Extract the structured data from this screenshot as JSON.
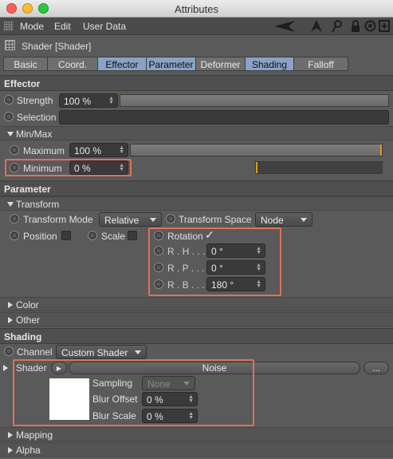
{
  "window": {
    "title": "Attributes"
  },
  "menu": {
    "items": [
      "Mode",
      "Edit",
      "User Data"
    ]
  },
  "toolbar_icons": [
    "pointer-arrow-icon",
    "cursor-up-icon",
    "search-icon",
    "lock-icon",
    "target-icon",
    "new-window-icon"
  ],
  "object": {
    "name": "Shader [Shader]"
  },
  "tabs": [
    {
      "label": "Basic",
      "active": false
    },
    {
      "label": "Coord.",
      "active": false
    },
    {
      "label": "Effector",
      "active": true
    },
    {
      "label": "Parameter",
      "active": true
    },
    {
      "label": "Deformer",
      "active": false
    },
    {
      "label": "Shading",
      "active": true
    },
    {
      "label": "Falloff",
      "active": false
    }
  ],
  "effector": {
    "header": "Effector",
    "strength": {
      "label": "Strength",
      "value": "100 %",
      "level": 1.0
    },
    "selection": {
      "label": "Selection",
      "value": ""
    },
    "minmax": {
      "header": "Min/Max",
      "maximum": {
        "label": "Maximum",
        "value": "100 %",
        "level": 1.0
      },
      "minimum": {
        "label": "Minimum",
        "value": "0 %",
        "level": 0.0
      }
    }
  },
  "parameter": {
    "header": "Parameter",
    "transform": {
      "header": "Transform",
      "mode_label": "Transform Mode",
      "mode_value": "Relative",
      "space_label": "Transform Space",
      "space_value": "Node",
      "position_label": "Position",
      "position_checked": false,
      "scale_label": "Scale",
      "scale_checked": false,
      "rotation_label": "Rotation",
      "rotation_checked": true,
      "rh_label": "R . H . . .",
      "rh_value": "0 °",
      "rp_label": "R . P . . .",
      "rp_value": "0 °",
      "rb_label": "R . B . . .",
      "rb_value": "180 °"
    },
    "color_header": "Color",
    "other_header": "Other"
  },
  "shading": {
    "header": "Shading",
    "channel_label": "Channel",
    "channel_value": "Custom Shader",
    "shader_label": "Shader",
    "shader_name": "Noise",
    "more_button": "...",
    "sampling_label": "Sampling",
    "sampling_value": "None",
    "blur_offset_label": "Blur Offset",
    "blur_offset_value": "0 %",
    "blur_scale_label": "Blur Scale",
    "blur_scale_value": "0 %",
    "mapping_header": "Mapping",
    "alpha_header": "Alpha"
  },
  "colors": {
    "accent_tab": "#8aa2c4",
    "highlight": "#e0705a",
    "slider_marker": "#e09a1a"
  }
}
